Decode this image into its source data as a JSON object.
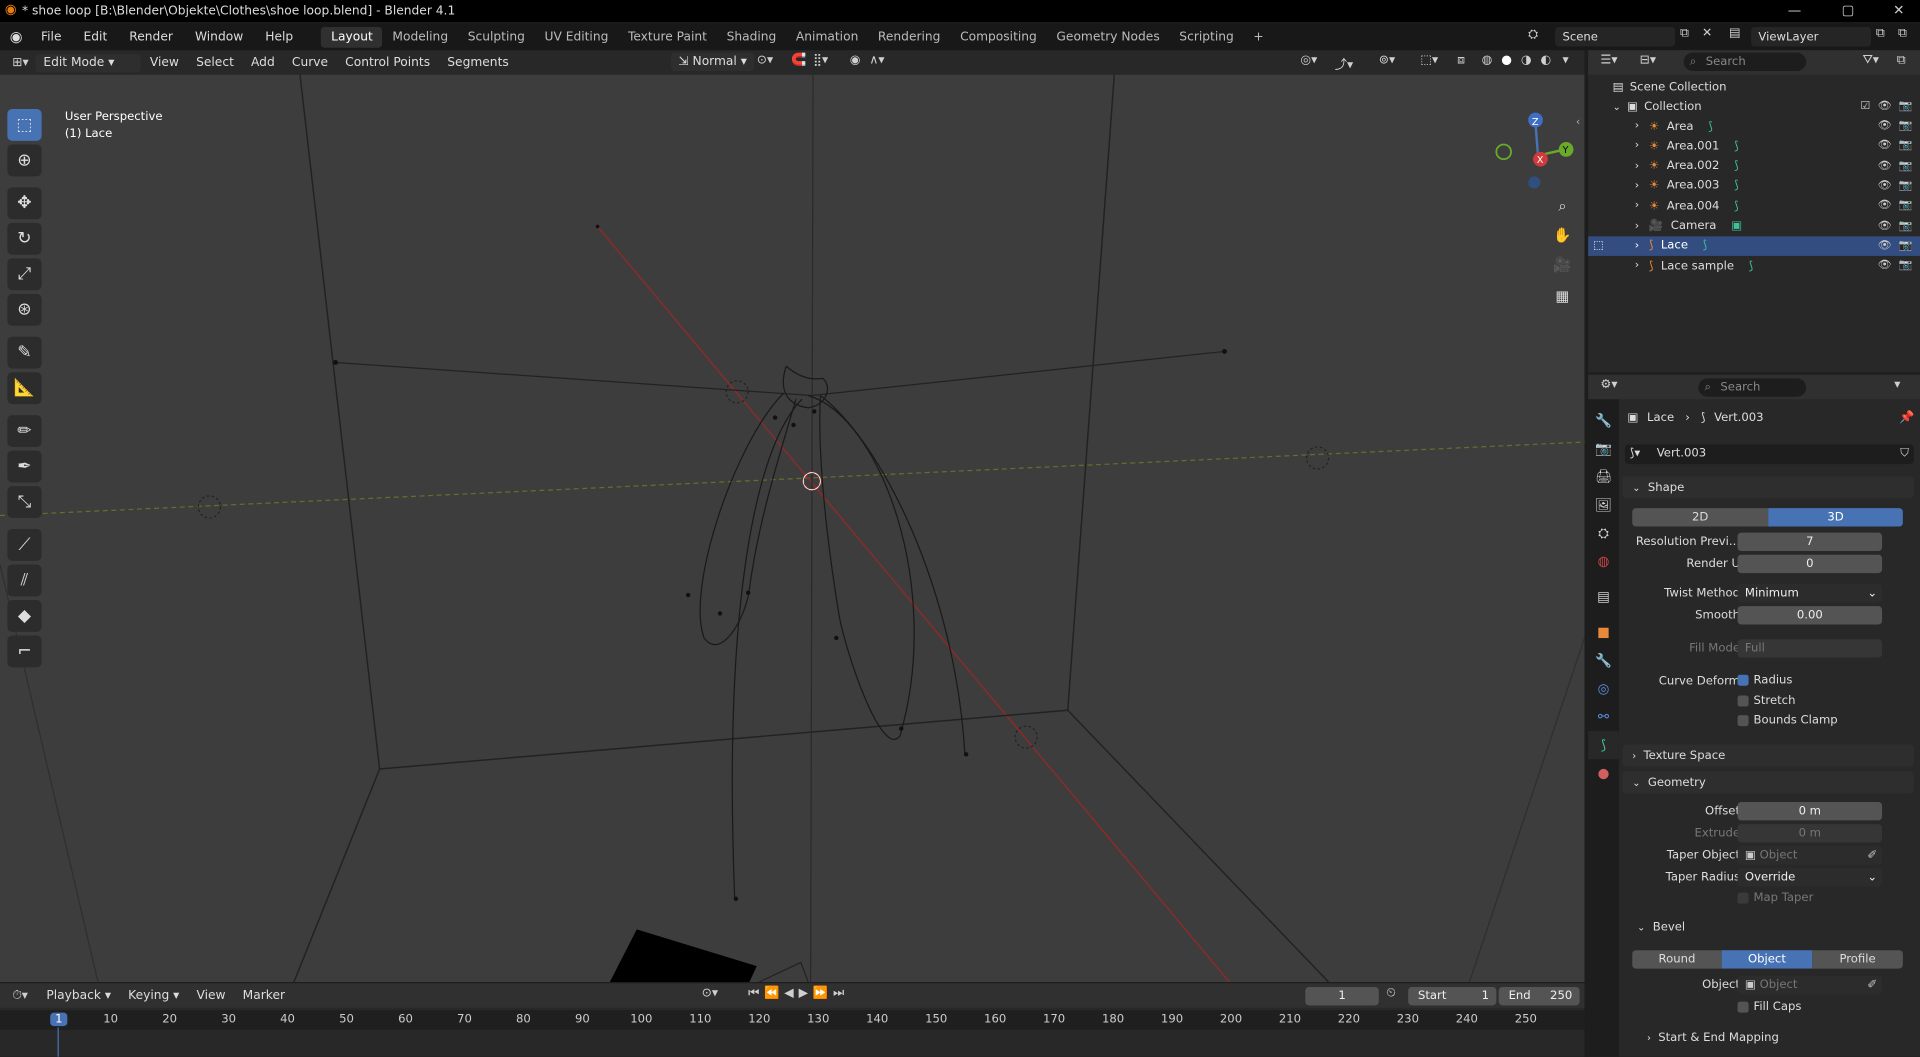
{
  "window": {
    "title": "* shoe loop [B:\\Blender\\Objekte\\Clothes\\shoe loop.blend] - Blender 4.1",
    "controls": [
      "minimize-icon",
      "maximize-icon",
      "close-icon"
    ]
  },
  "menubar": {
    "items": [
      "File",
      "Edit",
      "Render",
      "Window",
      "Help"
    ],
    "workspaces": [
      "Layout",
      "Modeling",
      "Sculpting",
      "UV Editing",
      "Texture Paint",
      "Shading",
      "Animation",
      "Rendering",
      "Compositing",
      "Geometry Nodes",
      "Scripting"
    ],
    "active_workspace": "Layout",
    "add_symbol": "+",
    "scene": "Scene",
    "view_layer": "ViewLayer"
  },
  "viewport_header": {
    "mode": "Edit Mode",
    "menus": [
      "View",
      "Select",
      "Add",
      "Curve",
      "Control Points",
      "Segments"
    ],
    "transform_orientation": "Normal"
  },
  "viewport": {
    "perspective": "User Perspective",
    "object_label": "(1) Lace",
    "gizmo_axes": [
      "Z",
      "Y",
      "X"
    ]
  },
  "outliner": {
    "search_placeholder": "Search",
    "root": "Scene Collection",
    "collection": "Collection",
    "items": [
      {
        "name": "Area",
        "type": "light",
        "selected": false
      },
      {
        "name": "Area.001",
        "type": "light",
        "selected": false
      },
      {
        "name": "Area.002",
        "type": "light",
        "selected": false
      },
      {
        "name": "Area.003",
        "type": "light",
        "selected": false
      },
      {
        "name": "Area.004",
        "type": "light",
        "selected": false
      },
      {
        "name": "Camera",
        "type": "camera",
        "selected": false
      },
      {
        "name": "Lace",
        "type": "curve",
        "selected": true
      },
      {
        "name": "Lace sample",
        "type": "curve",
        "selected": false
      }
    ]
  },
  "properties": {
    "search_placeholder": "Search",
    "breadcrumb": {
      "object": "Lace",
      "data": "Vert.003"
    },
    "datablock": "Vert.003",
    "shape": {
      "title": "Shape",
      "dim_2d": "2D",
      "dim_3d": "3D",
      "active_dim": "3D",
      "resolution_preview_label": "Resolution Previ...",
      "resolution_preview": "7",
      "render_u_label": "Render U",
      "render_u": "0",
      "twist_method_label": "Twist Method",
      "twist_method": "Minimum",
      "smooth_label": "Smooth",
      "smooth": "0.00",
      "fill_mode_label": "Fill Mode",
      "fill_mode": "Full",
      "curve_deform_label": "Curve Deform",
      "radius_label": "Radius",
      "radius": true,
      "stretch_label": "Stretch",
      "stretch": false,
      "bounds_clamp_label": "Bounds Clamp",
      "bounds_clamp": false
    },
    "texture_space_title": "Texture Space",
    "geometry": {
      "title": "Geometry",
      "offset_label": "Offset",
      "offset": "0 m",
      "extrude_label": "Extrude",
      "extrude": "0 m",
      "taper_object_label": "Taper Object",
      "taper_object_placeholder": "Object",
      "taper_radius_label": "Taper Radius",
      "taper_radius": "Override",
      "map_taper_label": "Map Taper"
    },
    "bevel": {
      "title": "Bevel",
      "modes": [
        "Round",
        "Object",
        "Profile"
      ],
      "active_mode": "Object",
      "object_label": "Object",
      "object_placeholder": "Object",
      "fill_caps_label": "Fill Caps",
      "fill_caps": false
    },
    "start_end_mapping_title": "Start & End Mapping"
  },
  "timeline": {
    "menus": [
      "Playback",
      "Keying",
      "View",
      "Marker"
    ],
    "current_frame": "1",
    "start_label": "Start",
    "start": "1",
    "end_label": "End",
    "end": "250",
    "ruler_frames": [
      "1",
      "10",
      "20",
      "30",
      "40",
      "50",
      "60",
      "70",
      "80",
      "90",
      "100",
      "110",
      "120",
      "130",
      "140",
      "150",
      "160",
      "170",
      "180",
      "190",
      "200",
      "210",
      "220",
      "230",
      "240",
      "250"
    ]
  }
}
